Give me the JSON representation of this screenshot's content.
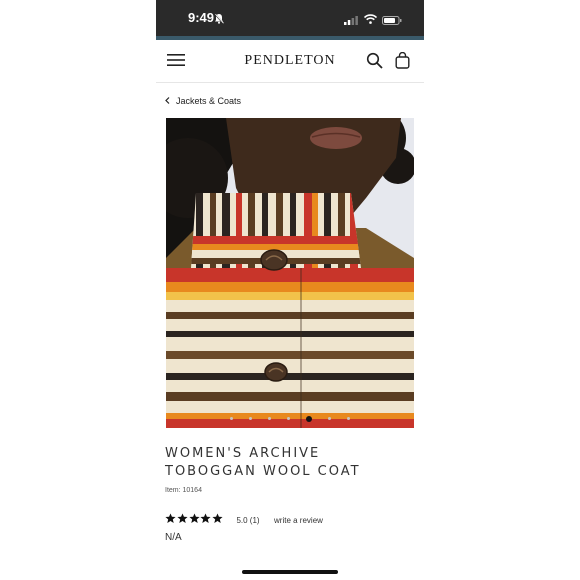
{
  "status_bar": {
    "time": "9:49",
    "icons": [
      "bell-muted-icon",
      "signal-icon",
      "wifi-icon",
      "battery-icon"
    ]
  },
  "header": {
    "logo": "PENDLETON",
    "icons": [
      "menu-icon",
      "search-icon",
      "shopping-bag-icon"
    ]
  },
  "breadcrumb": {
    "label": "Jackets & Coats"
  },
  "gallery": {
    "slide_count": 7,
    "active_index": 4
  },
  "product": {
    "title_line1": "WOMEN'S ARCHIVE",
    "title_line2": "TOBOGGAN WOOL COAT",
    "item_number": "Item: 10164",
    "rating_stars": 5,
    "rating_text": "5.0 (1)",
    "review_link": "write a review",
    "price": "N/A"
  },
  "colors": {
    "accent_bar": "#3a5a6a",
    "star": "#111111",
    "stripe_red": "#c8352a",
    "stripe_orange": "#e8891e",
    "stripe_cream": "#efe5cf",
    "stripe_brown": "#5a3d22"
  }
}
